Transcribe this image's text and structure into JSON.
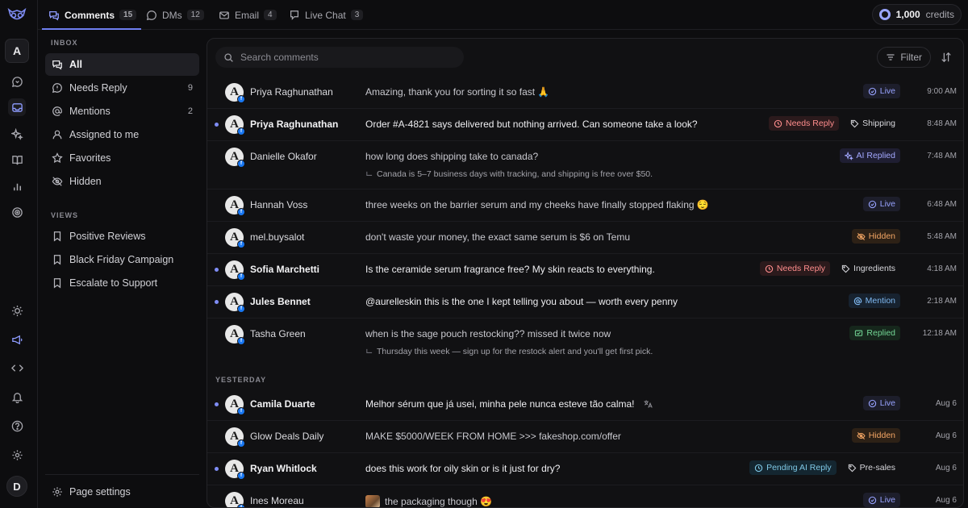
{
  "rail": {
    "workspace_initial": "A",
    "user_initial": "D"
  },
  "tabs": [
    {
      "label": "Comments",
      "count": "15"
    },
    {
      "label": "DMs",
      "count": "12"
    },
    {
      "label": "Email",
      "count": "4"
    },
    {
      "label": "Live Chat",
      "count": "3"
    }
  ],
  "credits": {
    "amount": "1,000",
    "label": "credits"
  },
  "sidebar": {
    "inbox_heading": "INBOX",
    "inbox": [
      {
        "label": "All",
        "count": ""
      },
      {
        "label": "Needs Reply",
        "count": "9"
      },
      {
        "label": "Mentions",
        "count": "2"
      },
      {
        "label": "Assigned to me",
        "count": ""
      },
      {
        "label": "Favorites",
        "count": ""
      },
      {
        "label": "Hidden",
        "count": ""
      }
    ],
    "views_heading": "VIEWS",
    "views": [
      {
        "label": "Positive Reviews"
      },
      {
        "label": "Black Friday Campaign"
      },
      {
        "label": "Escalate to Support"
      }
    ],
    "settings_label": "Page settings"
  },
  "toolbar": {
    "search_placeholder": "Search comments",
    "filter_label": "Filter"
  },
  "yesterday_heading": "YESTERDAY",
  "comments": [
    {
      "name": "Priya Raghunathan",
      "message": "Amazing, thank you for sorting it so fast 🙏",
      "reply": "",
      "tag1": "Live",
      "tag2": "",
      "time": "9:00 AM"
    },
    {
      "name": "Priya Raghunathan",
      "message": "Order #A-4821 says delivered but nothing arrived. Can someone take a look?",
      "reply": "",
      "tag1": "Needs Reply",
      "tag2": "Shipping",
      "time": "8:48 AM"
    },
    {
      "name": "Danielle Okafor",
      "message": "how long does shipping take to canada?",
      "reply": "Canada is 5–7 business days with tracking, and shipping is free over $50.",
      "tag1": "AI Replied",
      "tag2": "",
      "time": "7:48 AM"
    },
    {
      "name": "Hannah Voss",
      "message": "three weeks on the barrier serum and my cheeks have finally stopped flaking 😌",
      "reply": "",
      "tag1": "Live",
      "tag2": "",
      "time": "6:48 AM"
    },
    {
      "name": "mel.buysalot",
      "message": "don't waste your money, the exact same serum is $6 on Temu",
      "reply": "",
      "tag1": "Hidden",
      "tag2": "",
      "time": "5:48 AM"
    },
    {
      "name": "Sofia Marchetti",
      "message": "Is the ceramide serum fragrance free? My skin reacts to everything.",
      "reply": "",
      "tag1": "Needs Reply",
      "tag2": "Ingredients",
      "time": "4:18 AM"
    },
    {
      "name": "Jules Bennet",
      "message": "@aurelleskin this is the one I kept telling you about — worth every penny",
      "reply": "",
      "tag1": "Mention",
      "tag2": "",
      "time": "2:18 AM"
    },
    {
      "name": "Tasha Green",
      "message": "when is the sage pouch restocking?? missed it twice now",
      "reply": "Thursday this week — sign up for the restock alert and you'll get first pick.",
      "tag1": "Replied",
      "tag2": "",
      "time": "12:18 AM"
    },
    {
      "name": "Camila Duarte",
      "message": "Melhor sérum que já usei, minha pele nunca esteve tão calma!",
      "reply": "",
      "tag1": "Live",
      "tag2": "",
      "time": "Aug 6"
    },
    {
      "name": "Glow Deals Daily",
      "message": "MAKE $5000/WEEK FROM HOME >>> fakeshop.com/offer",
      "reply": "",
      "tag1": "Hidden",
      "tag2": "",
      "time": "Aug 6"
    },
    {
      "name": "Ryan Whitlock",
      "message": "does this work for oily skin or is it just for dry?",
      "reply": "",
      "tag1": "Pending AI Reply",
      "tag2": "Pre-sales",
      "time": "Aug 6"
    },
    {
      "name": "Ines Moreau",
      "message": "the packaging though 😍",
      "reply": "",
      "tag1": "Live",
      "tag2": "",
      "time": "Aug 6"
    }
  ],
  "avatar_letter": "A",
  "colors": {
    "accent": "#6f7ff0",
    "background": "#0d0d0f",
    "panel": "#111113"
  }
}
